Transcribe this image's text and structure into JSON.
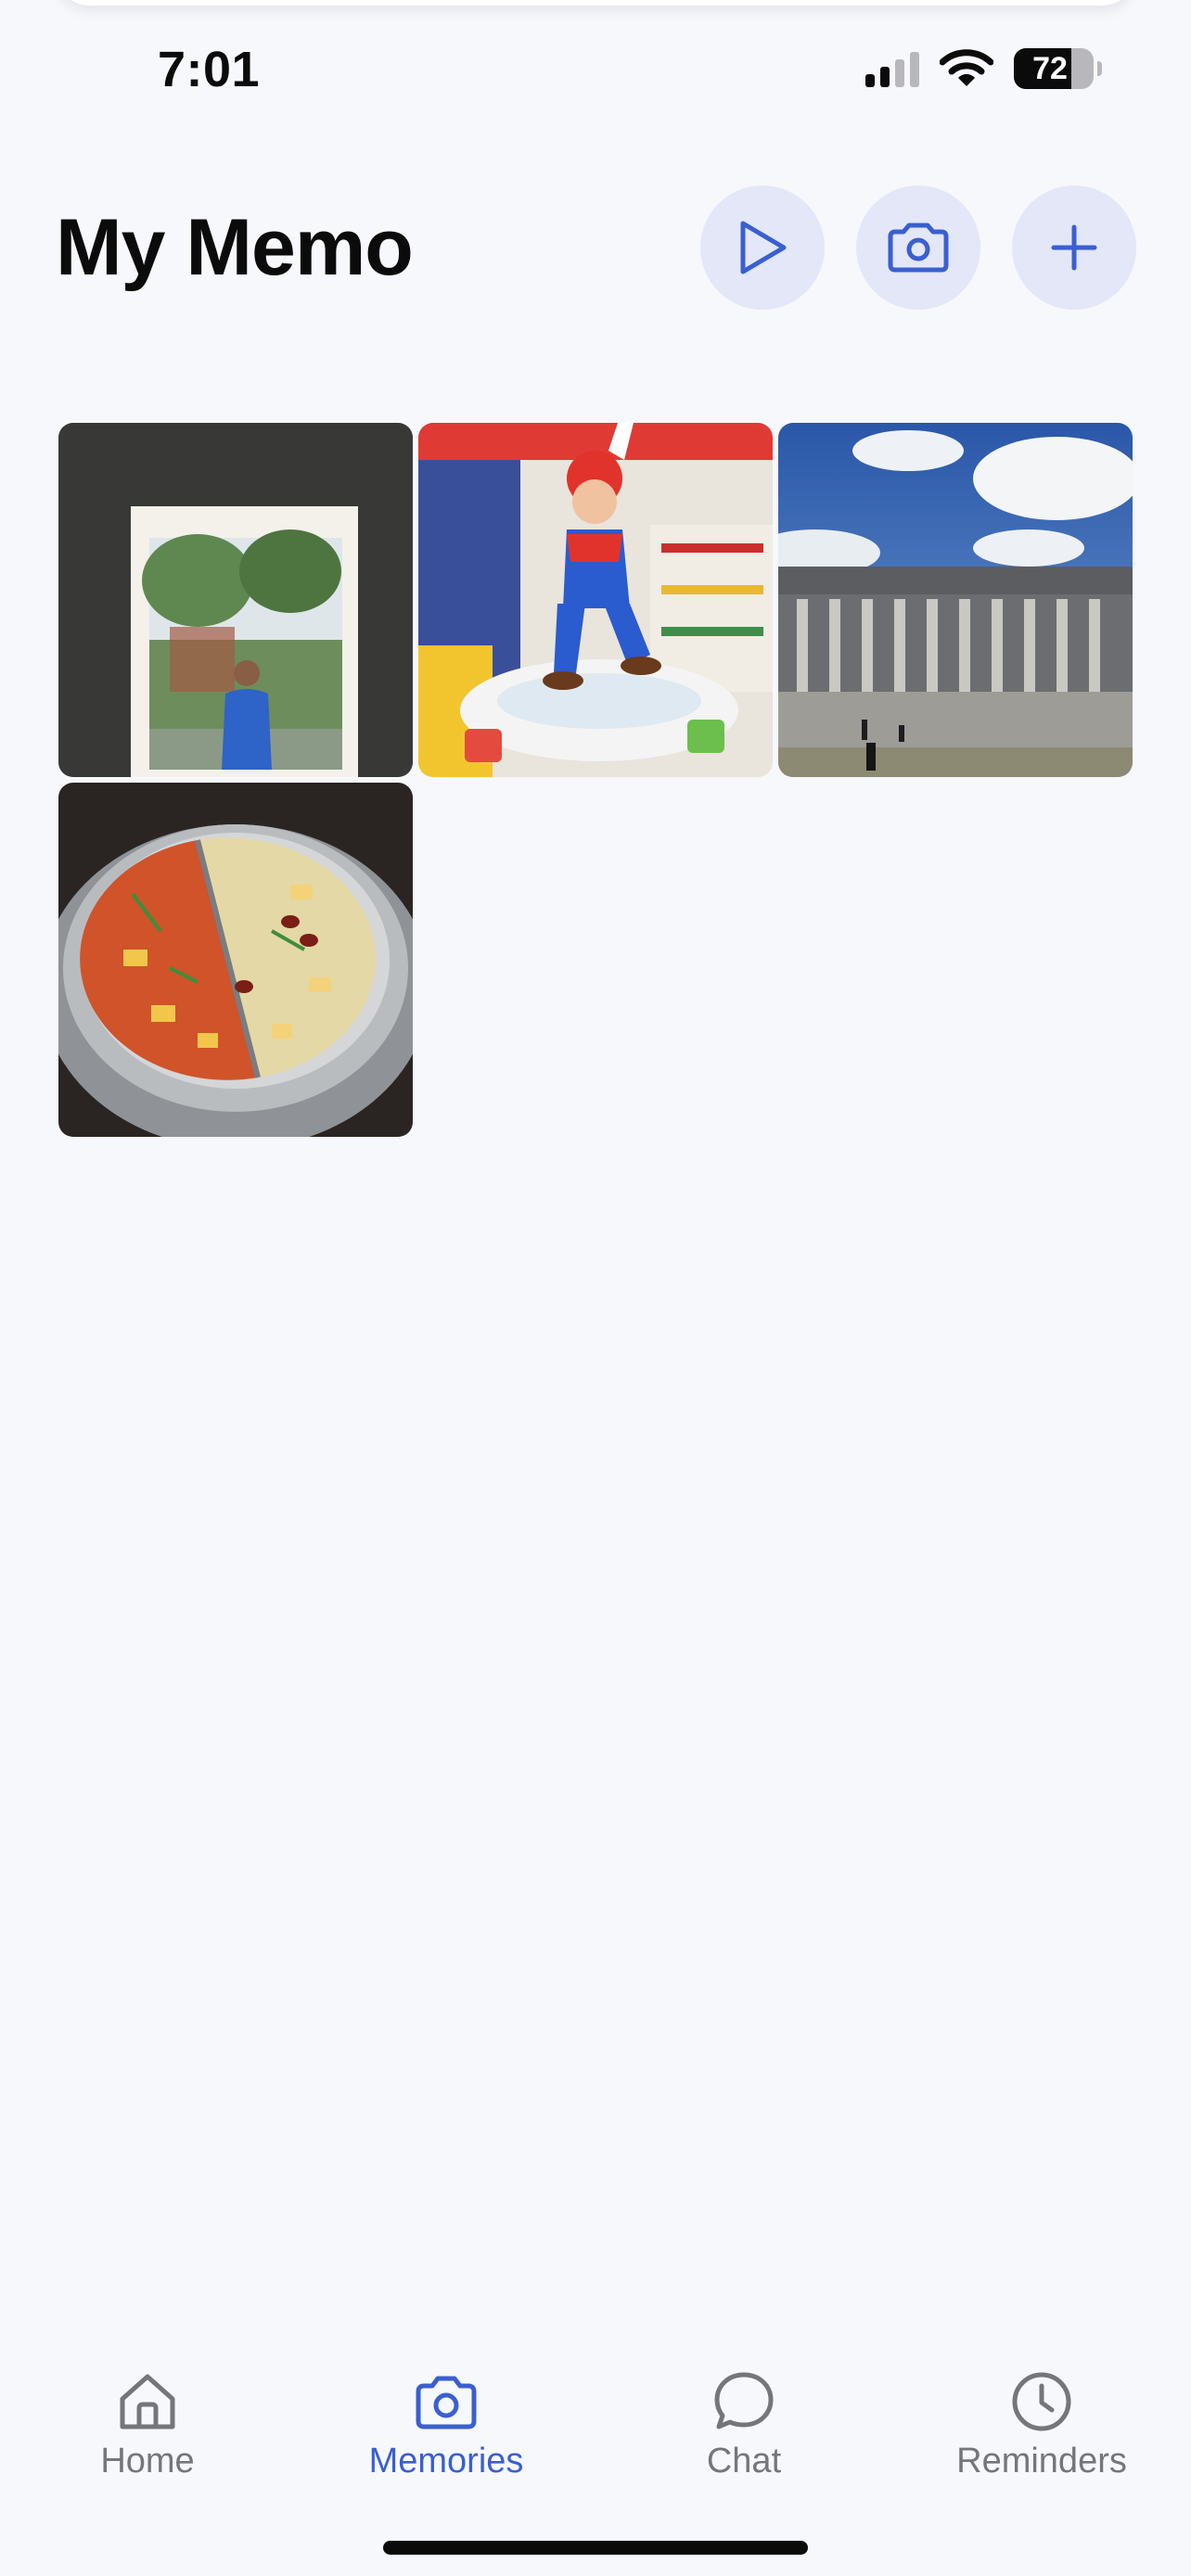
{
  "status_bar": {
    "time": "7:01",
    "battery_level": "72",
    "icons": [
      "signal-icon",
      "wifi-icon",
      "battery-icon"
    ]
  },
  "header": {
    "title": "My Memo",
    "actions": [
      {
        "icon": "play-icon"
      },
      {
        "icon": "camera-icon"
      },
      {
        "icon": "plus-icon"
      }
    ]
  },
  "memories": {
    "photos": [
      {
        "subject": "printed-photo-of-person-in-blue-shirt"
      },
      {
        "subject": "mario-figure-in-store"
      },
      {
        "subject": "columned-building-under-blue-sky"
      },
      {
        "subject": "split-hot-pot"
      }
    ]
  },
  "tab_bar": {
    "active": "Memories",
    "tabs": [
      {
        "label": "Home",
        "icon": "home-icon"
      },
      {
        "label": "Memories",
        "icon": "camera-icon"
      },
      {
        "label": "Chat",
        "icon": "chat-bubble-icon"
      },
      {
        "label": "Reminders",
        "icon": "clock-icon"
      }
    ]
  },
  "colors": {
    "accent": "#3a5fd1",
    "button_bg": "#e3e7f8",
    "background": "#f7f8fb",
    "inactive_tab": "#75767b"
  }
}
